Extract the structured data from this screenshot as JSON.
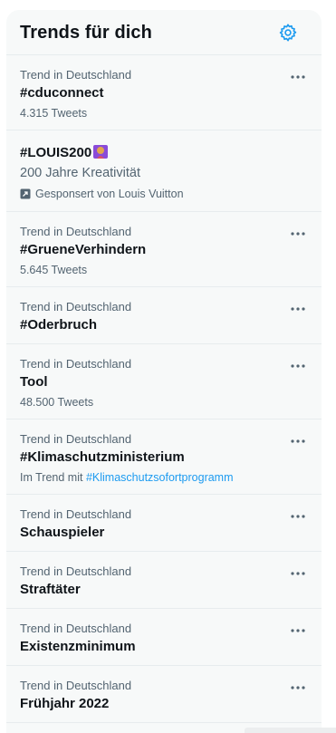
{
  "header": {
    "title": "Trends für dich",
    "settings_icon": "gear-icon",
    "accent_color": "#1d9bf0"
  },
  "trends": [
    {
      "context": "Trend in Deutschland",
      "name": "#cduconnect",
      "detail": "4.315 Tweets"
    },
    {
      "promoted": true,
      "name": "#LOUIS200",
      "emoji_icon": "louis-vuitton-emoji-icon",
      "description": "200 Jahre Kreativität",
      "promo_label": "Gesponsert von Louis Vuitton"
    },
    {
      "context": "Trend in Deutschland",
      "name": "#GrueneVerhindern",
      "detail": "5.645 Tweets"
    },
    {
      "context": "Trend in Deutschland",
      "name": "#Oderbruch"
    },
    {
      "context": "Trend in Deutschland",
      "name": "Tool",
      "detail": "48.500 Tweets"
    },
    {
      "context": "Trend in Deutschland",
      "name": "#Klimaschutzministerium",
      "detail_prefix": "Im Trend mit",
      "detail_link": "#Klimaschutzsofortprogramm"
    },
    {
      "context": "Trend in Deutschland",
      "name": "Schauspieler"
    },
    {
      "context": "Trend in Deutschland",
      "name": "Straftäter"
    },
    {
      "context": "Trend in Deutschland",
      "name": "Existenzminimum"
    },
    {
      "context": "Trend in Deutschland",
      "name": "Frühjahr 2022"
    }
  ]
}
